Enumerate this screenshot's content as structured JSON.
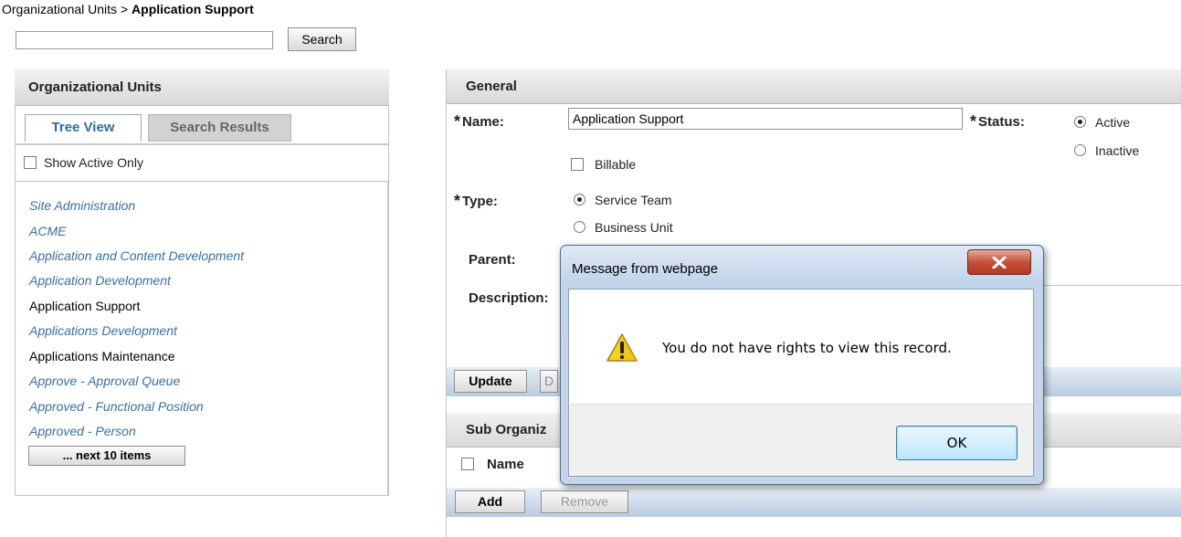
{
  "breadcrumb": {
    "root": "Organizational Units",
    "separator": ">",
    "current": "Application Support"
  },
  "search": {
    "value": "",
    "button_label": "Search"
  },
  "left_panel": {
    "title": "Organizational Units",
    "tabs": [
      {
        "label": "Tree View",
        "active": true
      },
      {
        "label": "Search Results",
        "active": false
      }
    ],
    "show_active_only_label": "Show Active Only",
    "tree_items": [
      {
        "label": "Site Administration",
        "link": true
      },
      {
        "label": "ACME",
        "link": true
      },
      {
        "label": "Application and Content Development",
        "link": true
      },
      {
        "label": "Application Development",
        "link": true
      },
      {
        "label": "Application Support",
        "link": false
      },
      {
        "label": "Applications Development",
        "link": true
      },
      {
        "label": "Applications Maintenance",
        "link": false
      },
      {
        "label": "Approve - Approval Queue",
        "link": true
      },
      {
        "label": "Approved - Functional Position",
        "link": true
      },
      {
        "label": "Approved - Person",
        "link": true
      }
    ],
    "next_button_label": "... next 10 items"
  },
  "general": {
    "title": "General",
    "name_label": "Name:",
    "name_value": "Application Support",
    "status_label": "Status:",
    "status_options": [
      {
        "label": "Active",
        "checked": true
      },
      {
        "label": "Inactive",
        "checked": false
      }
    ],
    "billable_label": "Billable",
    "type_label": "Type:",
    "type_options": [
      {
        "label": "Service Team",
        "checked": true
      },
      {
        "label": "Business Unit",
        "checked": false
      }
    ],
    "parent_label": "Parent:",
    "description_label": "Description:",
    "required_marker": "*",
    "update_label": "Update",
    "d_label": "D"
  },
  "sub_org": {
    "title": "Sub Organiz",
    "name_col": "Name",
    "add_label": "Add",
    "remove_label": "Remove"
  },
  "dialog": {
    "title": "Message from webpage",
    "message": "You do not have rights to view this record.",
    "ok_label": "OK",
    "icon": "warning-icon"
  }
}
